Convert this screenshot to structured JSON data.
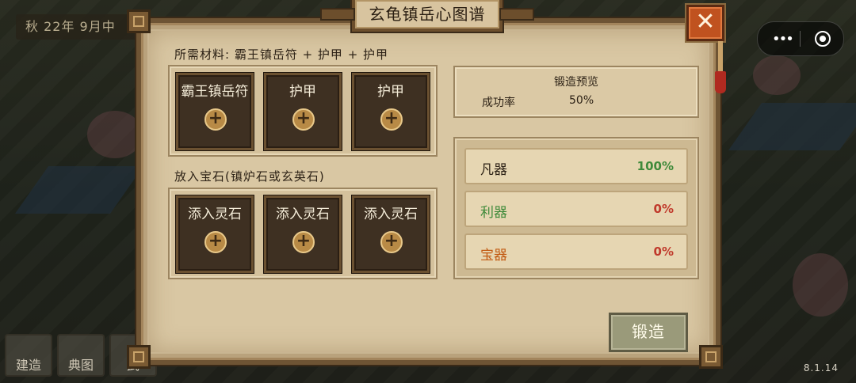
{
  "hud": {
    "date": "秋 22年 9月中",
    "version": "8.1.14",
    "capsule_dots": "•••",
    "bottom_buttons": [
      "建造",
      "典图",
      "武",
      "",
      "",
      "",
      ""
    ]
  },
  "dialog": {
    "title": "玄龟镇岳心图谱",
    "close_label": "✕",
    "materials_label": "所需材料: 霸王镇岳符 + 护甲 + 护甲",
    "material_slots": [
      {
        "label": "霸王镇岳符"
      },
      {
        "label": "护甲"
      },
      {
        "label": "护甲"
      }
    ],
    "gems_label": "放入宝石(镇炉石或玄英石)",
    "gem_slots": [
      {
        "label": "添入灵石"
      },
      {
        "label": "添入灵石"
      },
      {
        "label": "添入灵石"
      }
    ],
    "plus_symbol": "+",
    "preview": {
      "title": "锻造预览",
      "rate_label": "成功率",
      "rate_value": "50%"
    },
    "grades": [
      {
        "name": "凡器",
        "value": "100%",
        "name_color": "#2d2216",
        "value_color": "#3f8a3a"
      },
      {
        "name": "利器",
        "value": "0%",
        "name_color": "#3f8a3a",
        "value_color": "#c0392b"
      },
      {
        "name": "宝器",
        "value": "0%",
        "name_color": "#c25a12",
        "value_color": "#c0392b"
      }
    ],
    "forge_button": "锻造"
  }
}
